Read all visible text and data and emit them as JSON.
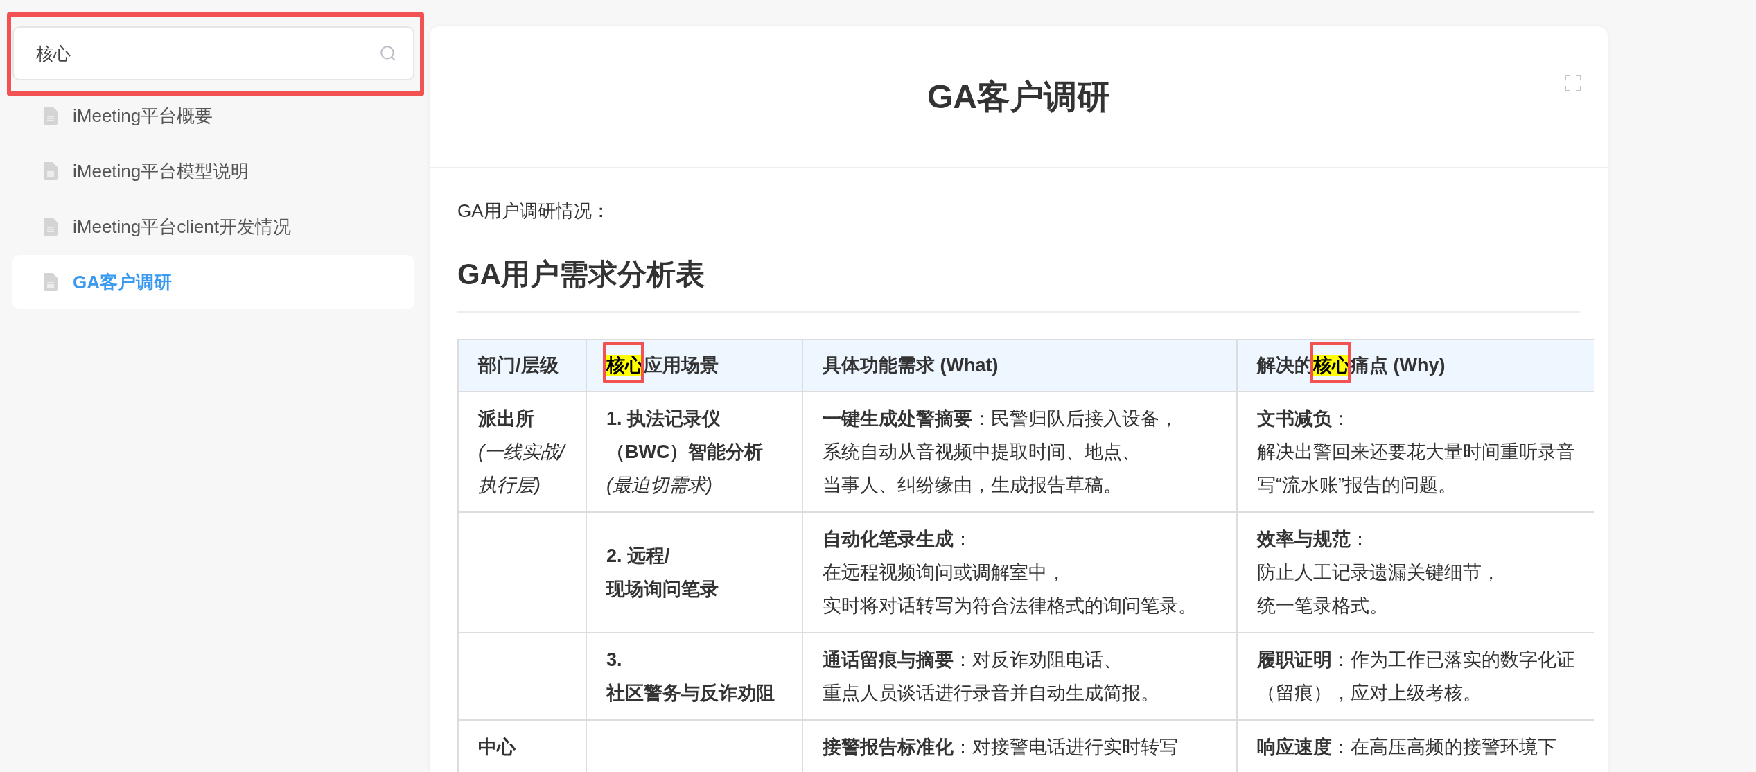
{
  "sidebar": {
    "search": {
      "value": "核心",
      "framed": true
    },
    "items": [
      {
        "label": "iMeeting平台概要",
        "selected": false
      },
      {
        "label": "iMeeting平台模型说明",
        "selected": false
      },
      {
        "label": "iMeeting平台client开发情况",
        "selected": false
      },
      {
        "label": "GA客户调研",
        "selected": true
      }
    ]
  },
  "document": {
    "title": "GA客户调研",
    "intro": "GA用户调研情况：",
    "heading": "GA用户需求分析表",
    "table": {
      "columns": [
        [
          {
            "text": "部门/层级",
            "highlight": false,
            "framed": false
          }
        ],
        [
          {
            "text": "核心",
            "highlight": true,
            "framed": true
          },
          {
            "text": "应用场景",
            "highlight": false,
            "framed": false
          }
        ],
        [
          {
            "text": "具体功能需求 (What)",
            "highlight": false,
            "framed": false
          }
        ],
        [
          {
            "text": "解决的",
            "highlight": false,
            "framed": false
          },
          {
            "text": "核心",
            "highlight": true,
            "framed": true
          },
          {
            "text": "痛点 (Why)",
            "highlight": false,
            "framed": false
          }
        ]
      ],
      "rows": [
        {
          "department": [
            "**派出所**",
            "*(一线实战/*",
            "*执行层)*"
          ],
          "scenario": [
            "**1. 执法记录仪**",
            "**（BWC）智能分析**",
            "*(最迫切需求)*"
          ],
          "what": [
            "**一键生成处警摘要**：民警归队后接入设备，",
            "系统自动从音视频中提取时间、地点、",
            "当事人、纠纷缘由，生成报告草稿。"
          ],
          "why": [
            "**文书减负**：",
            "解决出警回来还要花大量时间重听录音",
            "写“流水账”报告的问题。"
          ]
        },
        {
          "scenario": [
            "**2. 远程/**",
            "**现场询问笔录**"
          ],
          "what": [
            "**自动化笔录生成**：",
            "在远程视频询问或调解室中，",
            "实时将对话转写为符合法律格式的询问笔录。"
          ],
          "why": [
            "**效率与规范**：",
            "防止人工记录遗漏关键细节，",
            "统一笔录格式。"
          ]
        },
        {
          "scenario": [
            "**3.**",
            "**社区警务与反诈劝阻**"
          ],
          "what": [
            "**通话留痕与摘要**：对反诈劝阻电话、",
            "重点人员谈话进行录音并自动生成简报。"
          ],
          "why": [
            "**履职证明**：作为工作已落实的数字化证",
            "（留痕），应对上级考核。"
          ]
        },
        {
          "department": [
            "**中心**"
          ],
          "what": [
            "**接警报告标准化**：对接警电话进行实时转写"
          ],
          "why": [
            "**响应速度**：在高压高频的接警环境下"
          ]
        }
      ]
    }
  }
}
